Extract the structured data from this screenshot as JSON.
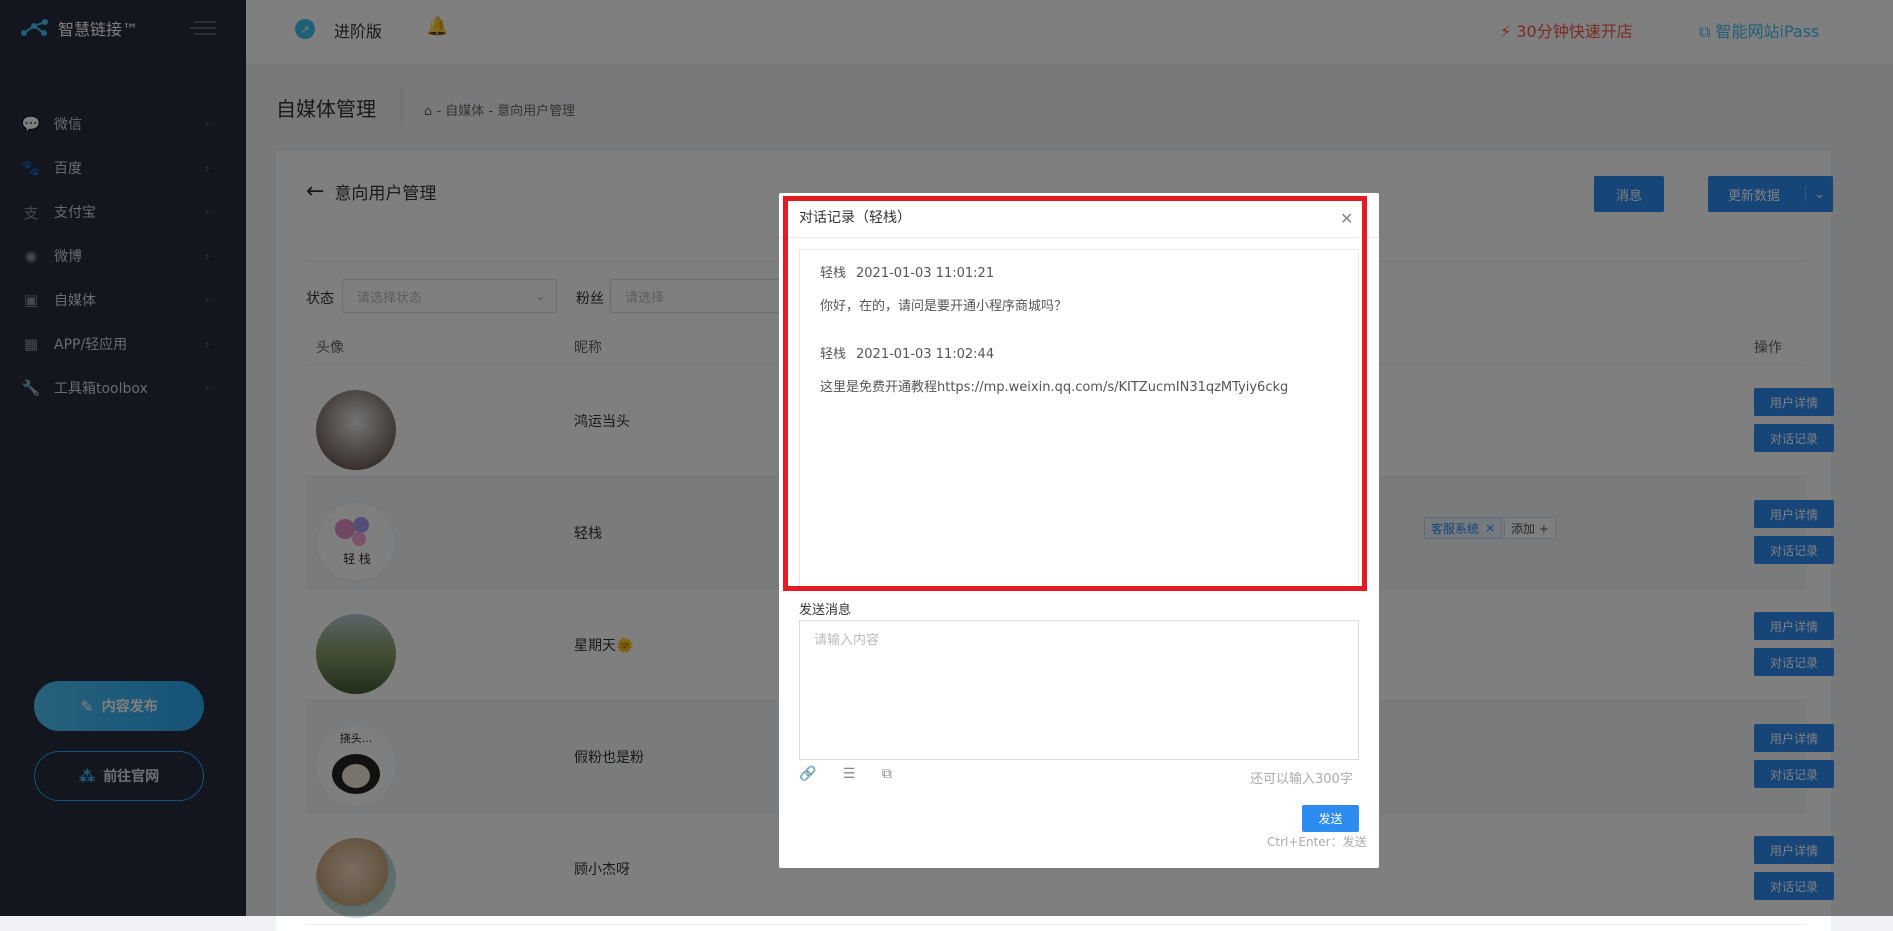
{
  "app": {
    "name": "智慧链接™"
  },
  "sidebar": {
    "items": [
      {
        "label": "微信",
        "icon": "wechat-icon"
      },
      {
        "label": "百度",
        "icon": "baidu-paw-icon"
      },
      {
        "label": "支付宝",
        "icon": "alipay-icon"
      },
      {
        "label": "微博",
        "icon": "weibo-icon"
      },
      {
        "label": "自媒体",
        "icon": "media-icon"
      },
      {
        "label": "APP/轻应用",
        "icon": "app-grid-icon"
      },
      {
        "label": "工具箱toolbox",
        "icon": "wrench-icon"
      }
    ],
    "publish_label": "内容发布",
    "website_label": "前往官网"
  },
  "topbar": {
    "version": "进阶版",
    "quick_open": "30分钟快速开店",
    "ipass": "智能网站iPass"
  },
  "page": {
    "title": "自媒体管理",
    "breadcrumb": "- 自媒体 - 意向用户管理",
    "section": "意向用户管理",
    "message_button": "消息",
    "update_button": "更新数据"
  },
  "filters": {
    "status_label": "状态",
    "status_placeholder": "请选择状态",
    "fans_label": "粉丝",
    "fans_placeholder": "请选择"
  },
  "table": {
    "columns": {
      "avatar": "头像",
      "nickname": "昵称",
      "actions": "操作"
    },
    "detail_label": "用户详情",
    "chat_label": "对话记录",
    "rows": [
      {
        "nickname": "鸿运当头"
      },
      {
        "nickname": "轻栈",
        "tag": "客服系统",
        "add_tag": "添加 +"
      },
      {
        "nickname": "星期天🌞"
      },
      {
        "nickname": "假粉也是粉"
      },
      {
        "nickname": "顾小杰呀"
      }
    ]
  },
  "modal": {
    "title": "对话记录（轻栈）",
    "messages": [
      {
        "sender": "轻栈",
        "time": "2021-01-03 11:01:21",
        "text": "你好，在的，请问是要开通小程序商城吗？"
      },
      {
        "sender": "轻栈",
        "time": "2021-01-03 11:02:44",
        "text": "这里是免费开通教程https://mp.weixin.qq.com/s/KITZucmIN31qzMTyiy6ckg"
      }
    ],
    "send_label": "发送消息",
    "input_placeholder": "请输入内容",
    "remaining": "还可以输入300字",
    "send_button": "发送",
    "shortcut_hint": "Ctrl+Enter：发送"
  },
  "colors": {
    "accent": "#2d8cf0",
    "highlight": "#e21b24",
    "sidebar": "#262b3e"
  }
}
